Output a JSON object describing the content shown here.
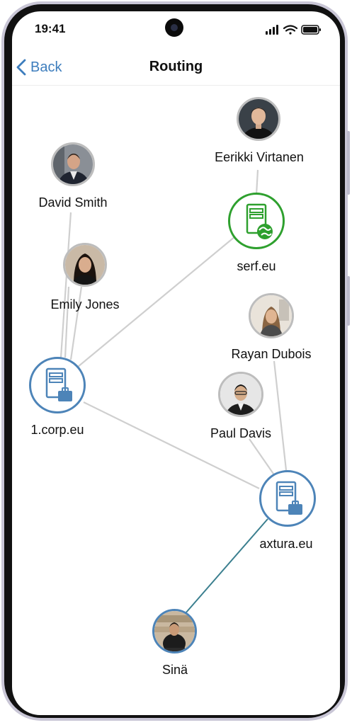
{
  "status_bar": {
    "time": "19:41"
  },
  "nav": {
    "back_label": "Back",
    "title": "Routing"
  },
  "nodes": {
    "eerikki": {
      "name": "Eerikki Virtanen"
    },
    "david": {
      "name": "David Smith"
    },
    "serf": {
      "name": "serf.eu"
    },
    "emily": {
      "name": "Emily Jones"
    },
    "rayan": {
      "name": "Rayan Dubois"
    },
    "corp": {
      "name": "1.corp.eu"
    },
    "paul": {
      "name": "Paul Davis"
    },
    "axtura": {
      "name": "axtura.eu"
    },
    "sina": {
      "name": "Sinä"
    }
  },
  "colors": {
    "accent": "#3d7dbd",
    "server_blue": "#4d84b8",
    "server_green": "#2ea02e",
    "edge_gray": "#cfcfcf",
    "edge_active": "#3b7f8f"
  }
}
